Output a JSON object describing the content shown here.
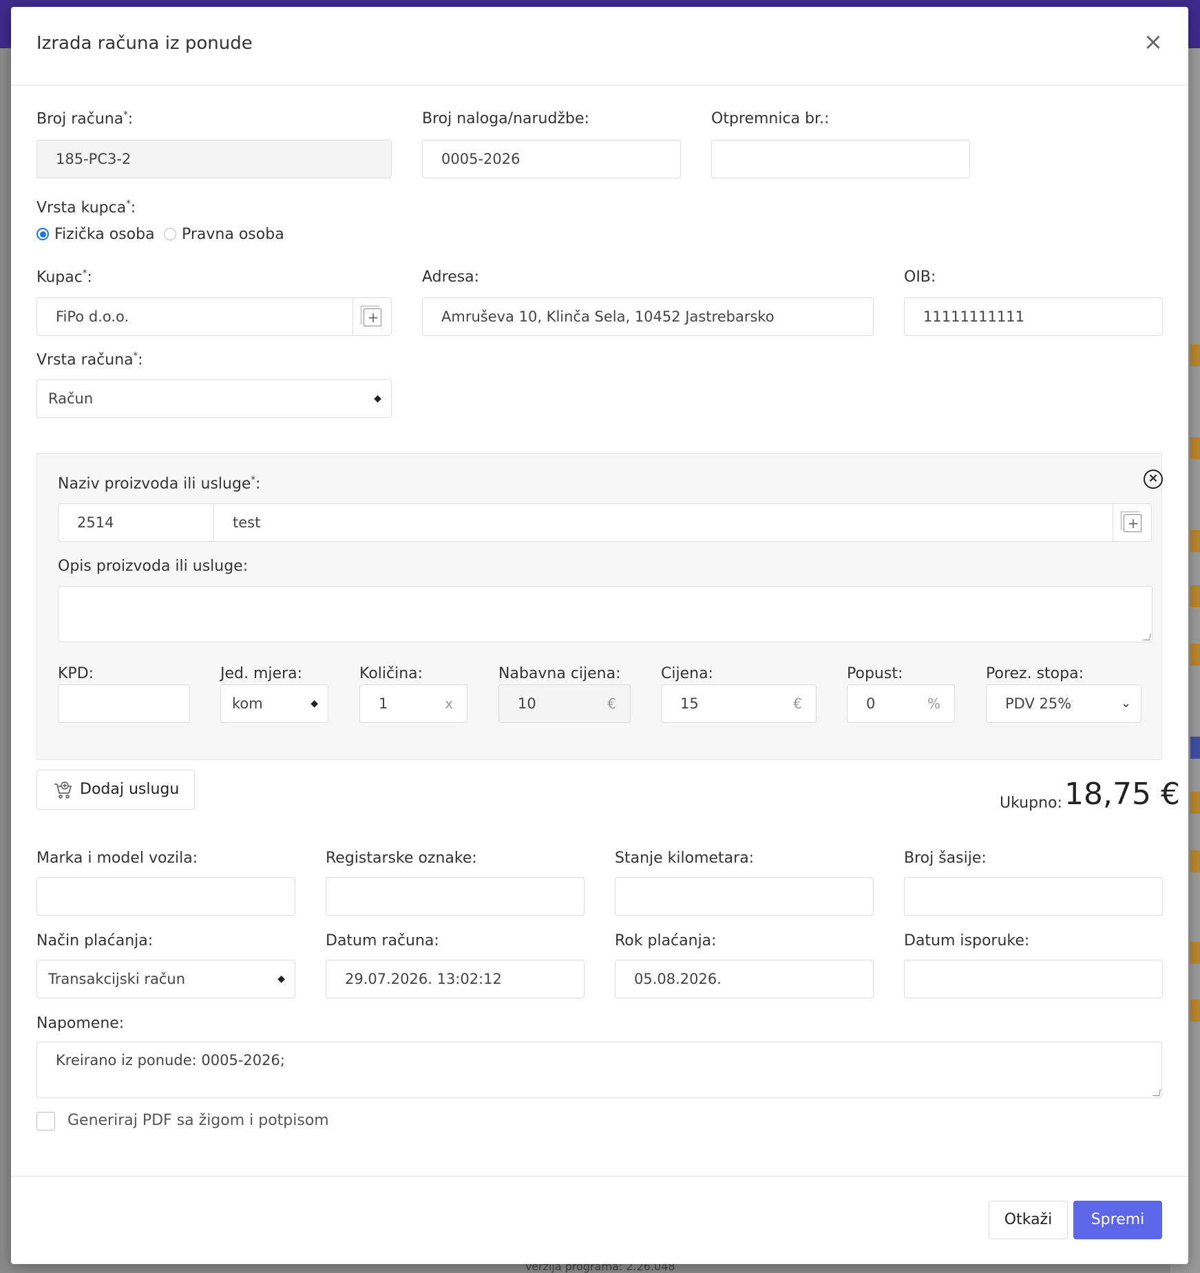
{
  "modal": {
    "title": "Izrada računa iz ponude",
    "close_icon": "close-icon"
  },
  "fields": {
    "invoice_no": {
      "label": "Broj računa",
      "value": "185-PC3-2"
    },
    "order_no": {
      "label": "Broj naloga/narudžbe:",
      "value": "0005-2026"
    },
    "delivery_note": {
      "label": "Otpremnica br.:",
      "value": ""
    },
    "customer_type": {
      "label": "Vrsta kupca",
      "options": [
        "Fizička osoba",
        "Pravna osoba"
      ],
      "selected": "Fizička osoba"
    },
    "customer": {
      "label": "Kupac",
      "value": "FiPo d.o.o."
    },
    "address": {
      "label": "Adresa:",
      "value": "Amruševa 10, Klinča Sela, 10452 Jastrebarsko"
    },
    "oib": {
      "label": "OIB:",
      "value": "11111111111"
    },
    "invoice_type": {
      "label": "Vrsta računa",
      "value": "Račun"
    }
  },
  "service": {
    "name_label": "Naziv proizvoda ili usluge",
    "code": "2514",
    "name": "test",
    "desc_label": "Opis proizvoda ili usluge:",
    "desc": "",
    "kpd": {
      "label": "KPD:",
      "value": ""
    },
    "unit": {
      "label": "Jed. mjera:",
      "value": "kom"
    },
    "qty": {
      "label": "Količina:",
      "value": "1",
      "suffix": "x"
    },
    "purchase_price": {
      "label": "Nabavna cijena:",
      "value": "10",
      "suffix": "€"
    },
    "price": {
      "label": "Cijena:",
      "value": "15",
      "suffix": "€"
    },
    "discount": {
      "label": "Popust:",
      "value": "0",
      "suffix": "%"
    },
    "tax": {
      "label": "Porez. stopa:",
      "value": "PDV 25%"
    }
  },
  "add_service_label": "Dodaj uslugu",
  "total": {
    "label": "Ukupno:",
    "value": "18,75 €"
  },
  "vehicle": {
    "model": {
      "label": "Marka i model vozila:",
      "value": ""
    },
    "plates": {
      "label": "Registarske oznake:",
      "value": ""
    },
    "km": {
      "label": "Stanje kilometara:",
      "value": ""
    },
    "chassis": {
      "label": "Broj šasije:",
      "value": ""
    }
  },
  "payment": {
    "method": {
      "label": "Način plaćanja:",
      "value": "Transakcijski račun"
    },
    "date": {
      "label": "Datum računa:",
      "value": "29.07.2026. 13:02:12"
    },
    "due": {
      "label": "Rok plaćanja:",
      "value": "05.08.2026."
    },
    "delivery_date": {
      "label": "Datum isporuke:",
      "value": ""
    }
  },
  "notes": {
    "label": "Napomene:",
    "value": "Kreirano iz ponude: 0005-2026;"
  },
  "pdf_checkbox_label": "Generiraj PDF sa žigom i potpisom",
  "buttons": {
    "cancel": "Otkaži",
    "save": "Spremi"
  },
  "footer_version": "Verzija programa: 2.26.048",
  "required_mark": "*",
  "colors": {
    "primary": "#5b67e8",
    "radio": "#1a73e8",
    "header_bg": "#3d2a8c"
  }
}
